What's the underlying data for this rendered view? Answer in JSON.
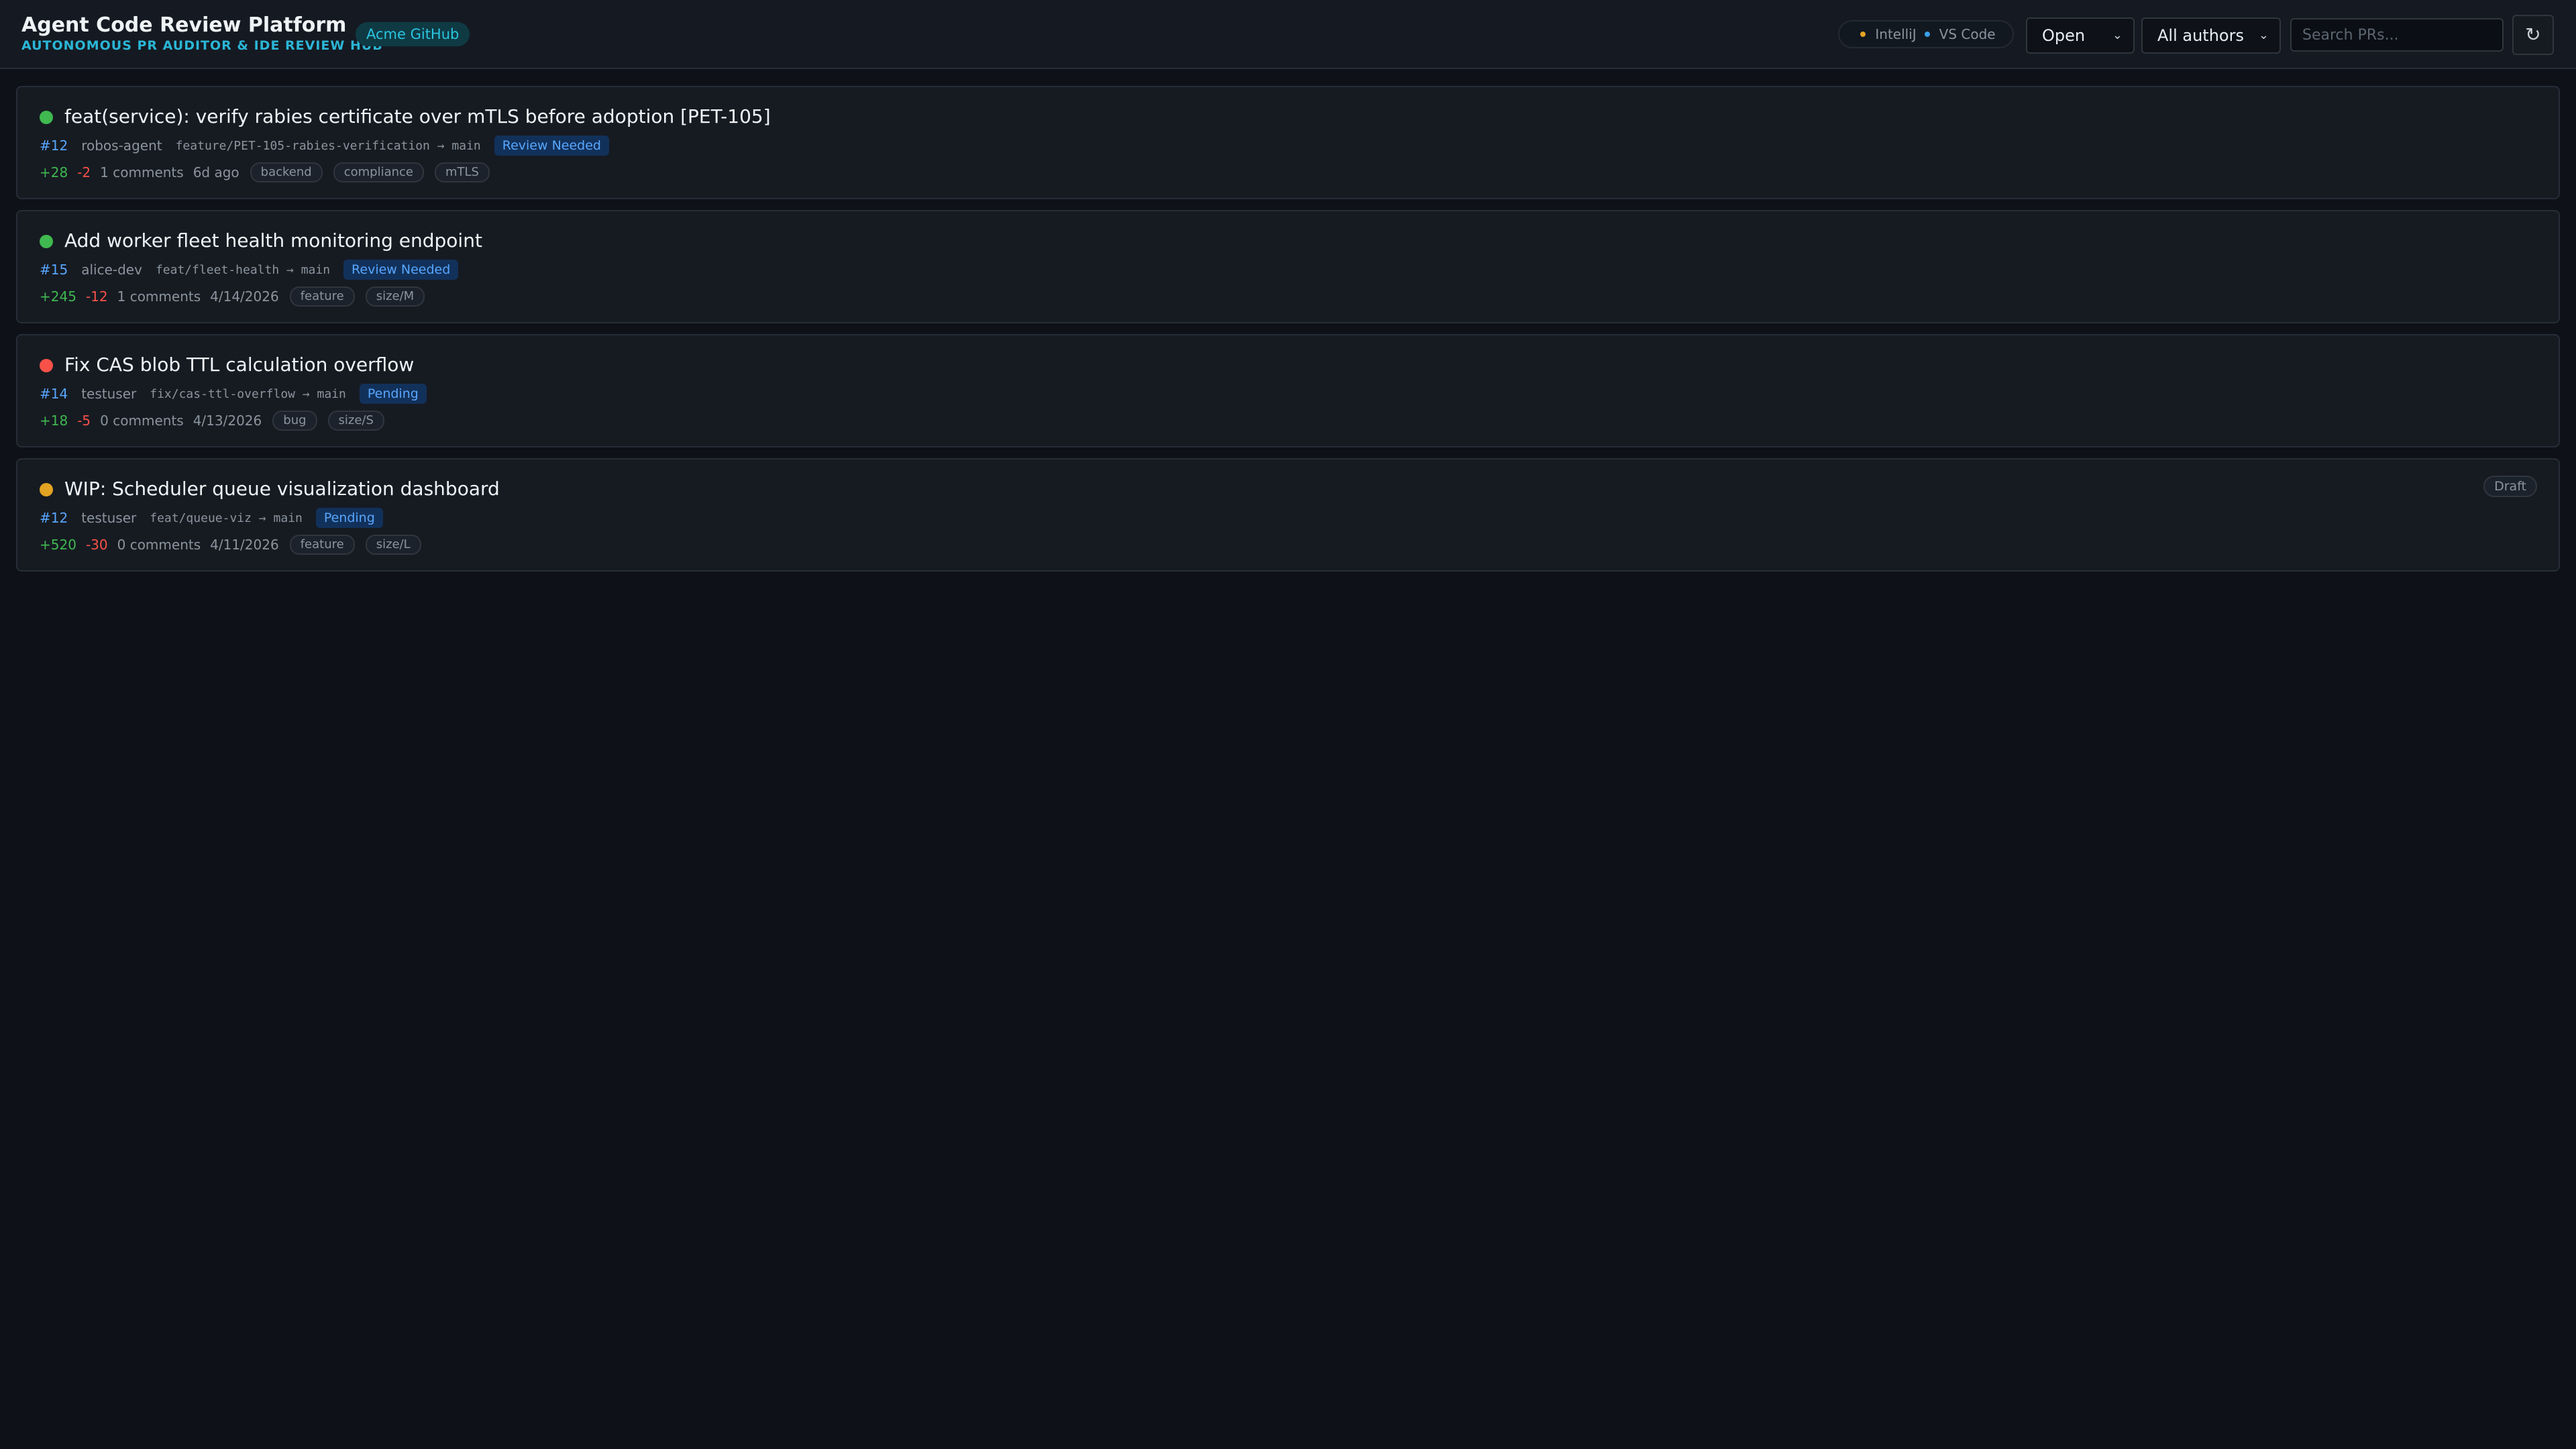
{
  "header": {
    "title": "Agent Code Review Platform",
    "subtitle": "AUTONOMOUS PR AUDITOR & IDE REVIEW HUB",
    "org_badge": "Acme GitHub",
    "ide_links": [
      {
        "label": "IntelliJ",
        "dot_color": "#e3a323"
      },
      {
        "label": "VS Code",
        "dot_color": "#3b9fe6"
      }
    ],
    "state_filter": "Open",
    "author_filter": "All authors",
    "search_placeholder": "Search PRs...",
    "refresh_icon": "refresh-icon"
  },
  "colors": {
    "status_green": "#3fb950",
    "status_red": "#f85149",
    "status_orange": "#e3a323",
    "accent_cyan": "#2bb6d6",
    "link_blue": "#58a6ff"
  },
  "pull_requests": [
    {
      "status_color": "#3fb950",
      "title": "feat(service): verify rabies certificate over mTLS before adoption [PET-105]",
      "number": "#12",
      "author": "robos-agent",
      "branch": "feature/PET-105-rabies-verification → main",
      "review_status": "Review Needed",
      "additions": "+28",
      "deletions": "-2",
      "comments": "1 comments",
      "date": "6d ago",
      "labels": [
        "backend",
        "compliance",
        "mTLS"
      ],
      "draft": ""
    },
    {
      "status_color": "#3fb950",
      "title": "Add worker fleet health monitoring endpoint",
      "number": "#15",
      "author": "alice-dev",
      "branch": "feat/fleet-health → main",
      "review_status": "Review Needed",
      "additions": "+245",
      "deletions": "-12",
      "comments": "1 comments",
      "date": "4/14/2026",
      "labels": [
        "feature",
        "size/M"
      ],
      "draft": ""
    },
    {
      "status_color": "#f85149",
      "title": "Fix CAS blob TTL calculation overflow",
      "number": "#14",
      "author": "testuser",
      "branch": "fix/cas-ttl-overflow → main",
      "review_status": "Pending",
      "additions": "+18",
      "deletions": "-5",
      "comments": "0 comments",
      "date": "4/13/2026",
      "labels": [
        "bug",
        "size/S"
      ],
      "draft": ""
    },
    {
      "status_color": "#e3a323",
      "title": "WIP: Scheduler queue visualization dashboard",
      "number": "#12",
      "author": "testuser",
      "branch": "feat/queue-viz → main",
      "review_status": "Pending",
      "additions": "+520",
      "deletions": "-30",
      "comments": "0 comments",
      "date": "4/11/2026",
      "labels": [
        "feature",
        "size/L"
      ],
      "draft": "Draft"
    }
  ]
}
